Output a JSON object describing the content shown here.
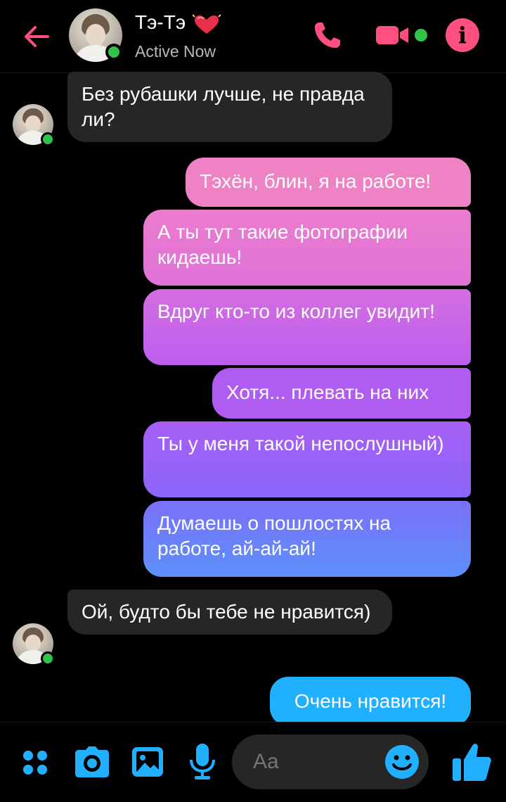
{
  "header": {
    "contact_name": "Тэ-Тэ",
    "status": "Active Now",
    "icons": [
      "back-arrow-icon",
      "heart-icon",
      "phone-icon",
      "video-camera-icon",
      "info-icon"
    ]
  },
  "messages": [
    {
      "from": "contact",
      "text": "Без рубашки лучше, не правда ли?"
    },
    {
      "from": "me",
      "text": "Тэхён, блин, я на работе!"
    },
    {
      "from": "me",
      "text": "А ты тут такие фотографии кидаешь!"
    },
    {
      "from": "me",
      "text": "Вдруг кто-то из коллег увидит!"
    },
    {
      "from": "me",
      "text": "Хотя... плевать на них"
    },
    {
      "from": "me",
      "text": "Ты у меня такой непослушный)"
    },
    {
      "from": "me",
      "text": "Думаешь о пошлостях на работе, ай-ай-ай!"
    },
    {
      "from": "contact",
      "text": "Ой, будто бы тебе не нравится)"
    },
    {
      "from": "me",
      "text": "Очень нравится!"
    }
  ],
  "composer": {
    "placeholder": "Aa",
    "icons": [
      "apps-grid-icon",
      "camera-icon",
      "gallery-icon",
      "microphone-icon",
      "emoji-icon",
      "thumbs-up-icon"
    ]
  },
  "colors": {
    "accent_red": "#ff4f7e",
    "accent_blue": "#21b0ff",
    "online_green": "#31c24a",
    "gradient_pink": "#ef7ec8",
    "gradient_purple": "#b05cf2",
    "gradient_blue": "#5b90f9",
    "incoming_bubble": "#262626"
  }
}
